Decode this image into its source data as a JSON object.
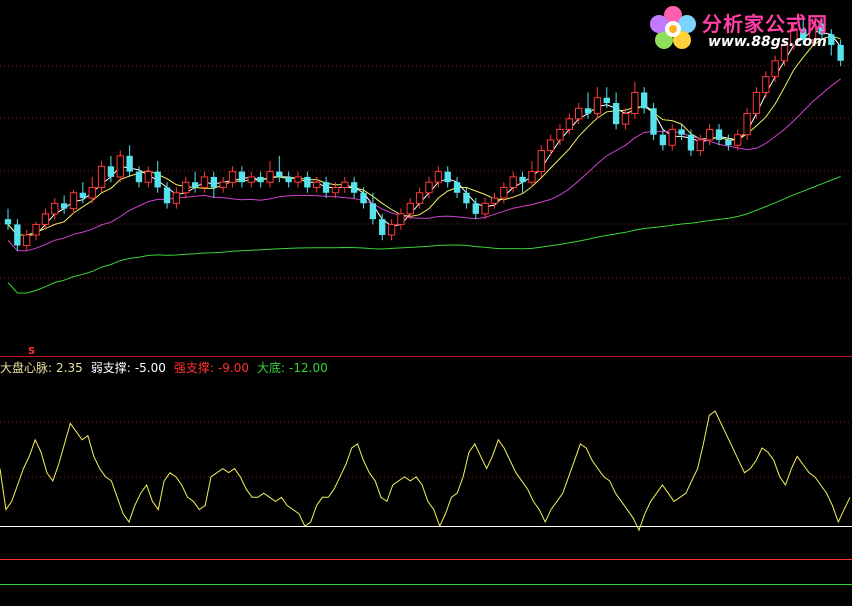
{
  "logo": {
    "title": "分析家公式网",
    "url": "www.88gs.com"
  },
  "colors": {
    "background": "#000000",
    "grid": "#8a1a1a",
    "separator": "#c8101a",
    "candle_up": "#ff3838",
    "candle_down": "#56e3ee",
    "ma_short": "#ffffff",
    "ma_mid": "#f0f060",
    "ma_long": "#d040d0",
    "ma_longest": "#3ad43a",
    "indicator_line": "#f4f05a",
    "weak_support": "#ffffff",
    "strong_support": "#ff3030",
    "bottom": "#34d634"
  },
  "indicator": {
    "name_label": "大盘心脉:",
    "name_value": "2.35",
    "weak_label": "弱支撑:",
    "weak_value": "-5.00",
    "strong_label": "强支撑:",
    "strong_value": "-9.00",
    "bottom_label": "大底:",
    "bottom_value": "-12.00"
  },
  "markers": {
    "signal_glyph": "S"
  },
  "chart_data": [
    {
      "type": "candlestick",
      "title": "",
      "panel": "price",
      "y_range": [
        0,
        100
      ],
      "grid": true,
      "candles": [
        [
          56,
          54,
          60,
          52
        ],
        [
          54,
          46,
          56,
          44
        ],
        [
          46,
          50,
          52,
          44
        ],
        [
          50,
          54,
          55,
          48
        ],
        [
          54,
          58,
          60,
          52
        ],
        [
          58,
          62,
          64,
          56
        ],
        [
          62,
          60,
          65,
          58
        ],
        [
          60,
          66,
          67,
          58
        ],
        [
          66,
          64,
          70,
          62
        ],
        [
          64,
          68,
          72,
          62
        ],
        [
          68,
          76,
          78,
          66
        ],
        [
          76,
          72,
          80,
          70
        ],
        [
          72,
          80,
          82,
          70
        ],
        [
          80,
          74,
          84,
          72
        ],
        [
          74,
          70,
          76,
          68
        ],
        [
          70,
          74,
          76,
          68
        ],
        [
          74,
          68,
          78,
          66
        ],
        [
          68,
          62,
          70,
          60
        ],
        [
          62,
          66,
          68,
          60
        ],
        [
          66,
          70,
          72,
          64
        ],
        [
          70,
          68,
          74,
          66
        ],
        [
          68,
          72,
          74,
          66
        ],
        [
          72,
          68,
          74,
          64
        ],
        [
          68,
          70,
          72,
          66
        ],
        [
          70,
          74,
          76,
          68
        ],
        [
          74,
          70,
          76,
          68
        ],
        [
          70,
          72,
          74,
          68
        ],
        [
          72,
          70,
          74,
          68
        ],
        [
          70,
          74,
          78,
          68
        ],
        [
          74,
          72,
          80,
          70
        ],
        [
          72,
          70,
          74,
          68
        ],
        [
          70,
          72,
          74,
          68
        ],
        [
          72,
          68,
          74,
          66
        ],
        [
          68,
          70,
          72,
          66
        ],
        [
          70,
          66,
          72,
          64
        ],
        [
          66,
          68,
          70,
          64
        ],
        [
          68,
          70,
          72,
          66
        ],
        [
          70,
          66,
          72,
          64
        ],
        [
          66,
          62,
          68,
          60
        ],
        [
          62,
          56,
          66,
          54
        ],
        [
          56,
          50,
          58,
          48
        ],
        [
          50,
          54,
          56,
          48
        ],
        [
          54,
          58,
          60,
          52
        ],
        [
          58,
          62,
          64,
          56
        ],
        [
          62,
          66,
          68,
          60
        ],
        [
          66,
          70,
          72,
          64
        ],
        [
          70,
          74,
          76,
          68
        ],
        [
          74,
          70,
          76,
          68
        ],
        [
          70,
          66,
          72,
          64
        ],
        [
          66,
          62,
          68,
          60
        ],
        [
          62,
          58,
          64,
          56
        ],
        [
          58,
          62,
          64,
          56
        ],
        [
          62,
          64,
          66,
          60
        ],
        [
          64,
          68,
          70,
          62
        ],
        [
          68,
          72,
          74,
          66
        ],
        [
          72,
          70,
          74,
          66
        ],
        [
          70,
          74,
          78,
          68
        ],
        [
          74,
          82,
          84,
          72
        ],
        [
          82,
          86,
          88,
          80
        ],
        [
          86,
          90,
          92,
          84
        ],
        [
          90,
          94,
          96,
          88
        ],
        [
          94,
          98,
          100,
          92
        ],
        [
          98,
          96,
          104,
          94
        ],
        [
          96,
          102,
          106,
          94
        ],
        [
          102,
          100,
          106,
          98
        ],
        [
          100,
          92,
          104,
          90
        ],
        [
          92,
          96,
          98,
          90
        ],
        [
          96,
          104,
          108,
          94
        ],
        [
          104,
          98,
          106,
          96
        ],
        [
          98,
          88,
          100,
          86
        ],
        [
          88,
          84,
          90,
          82
        ],
        [
          84,
          90,
          92,
          82
        ],
        [
          90,
          88,
          92,
          86
        ],
        [
          88,
          82,
          90,
          80
        ],
        [
          82,
          86,
          88,
          80
        ],
        [
          86,
          90,
          92,
          84
        ],
        [
          90,
          86,
          92,
          84
        ],
        [
          86,
          84,
          88,
          82
        ],
        [
          84,
          88,
          90,
          82
        ],
        [
          88,
          96,
          98,
          86
        ],
        [
          96,
          104,
          106,
          94
        ],
        [
          104,
          110,
          112,
          102
        ],
        [
          110,
          116,
          118,
          108
        ],
        [
          116,
          122,
          124,
          114
        ],
        [
          122,
          128,
          130,
          120
        ],
        [
          128,
          124,
          132,
          122
        ],
        [
          124,
          130,
          132,
          122
        ],
        [
          130,
          126,
          132,
          124
        ],
        [
          126,
          122,
          128,
          118
        ],
        [
          122,
          116,
          124,
          114
        ]
      ],
      "series": [
        {
          "name": "",
          "color_key": "ma_short"
        },
        {
          "name": "",
          "color_key": "ma_mid"
        },
        {
          "name": "",
          "color_key": "ma_long"
        },
        {
          "name": "",
          "color_key": "ma_longest"
        }
      ]
    },
    {
      "type": "line",
      "title": "",
      "panel": "indicator",
      "y_range": [
        -14,
        14
      ],
      "grid": true,
      "values": [
        2.0,
        -3.0,
        -2.0,
        0,
        2.0,
        3.5,
        5.5,
        4.0,
        1.5,
        0.5,
        2.5,
        5.0,
        7.5,
        6.5,
        5.5,
        6.0,
        3.5,
        2.0,
        1.0,
        0.5,
        -1.5,
        -3.5,
        -4.5,
        -2.5,
        -1.0,
        0,
        -2.0,
        -3.0,
        0.5,
        1.5,
        1.0,
        0,
        -1.5,
        -2.0,
        -3.0,
        -2.5,
        1.0,
        1.5,
        2.0,
        1.5,
        2.0,
        1.0,
        -0.5,
        -1.5,
        -1.5,
        -1.0,
        -1.5,
        -2.0,
        -1.5,
        -2.5,
        -3.0,
        -3.5,
        -5.0,
        -4.5,
        -2.5,
        -1.5,
        -1.5,
        -0.5,
        1.0,
        2.5,
        4.5,
        5.0,
        3.0,
        1.5,
        0.5,
        -1.5,
        -2.0,
        0,
        0.5,
        1.0,
        0.5,
        1.0,
        0,
        -2.0,
        -3.0,
        -5.0,
        -3.5,
        -1.5,
        -1.0,
        1.0,
        4.0,
        5.0,
        3.5,
        2.0,
        3.5,
        5.5,
        4.5,
        3.0,
        1.5,
        0.5,
        -0.5,
        -2.0,
        -3.0,
        -4.5,
        -3.0,
        -2.0,
        -1.0,
        1.0,
        3.0,
        5.0,
        4.5,
        3.0,
        2.0,
        1.0,
        0.5,
        -1.0,
        -2.0,
        -3.0,
        -4.0,
        -5.5,
        -3.5,
        -2.0,
        -1.0,
        0,
        -1.0,
        -2.0,
        -1.5,
        -1.0,
        0.5,
        2.0,
        5.0,
        8.5,
        9.0,
        7.5,
        6.0,
        4.5,
        3.0,
        1.5,
        2.0,
        3.0,
        4.5,
        4.0,
        3.0,
        1.0,
        0,
        2.0,
        3.5,
        2.5,
        1.5,
        1.0,
        0,
        -1.0,
        -2.5,
        -4.5,
        -3.0,
        -1.5
      ],
      "levels": [
        {
          "name": "弱支撑",
          "value": -5.0,
          "color_key": "weak_support"
        },
        {
          "name": "强支撑",
          "value": -9.0,
          "color_key": "strong_support"
        },
        {
          "name": "大底",
          "value": -12.0,
          "color_key": "bottom"
        }
      ]
    }
  ]
}
